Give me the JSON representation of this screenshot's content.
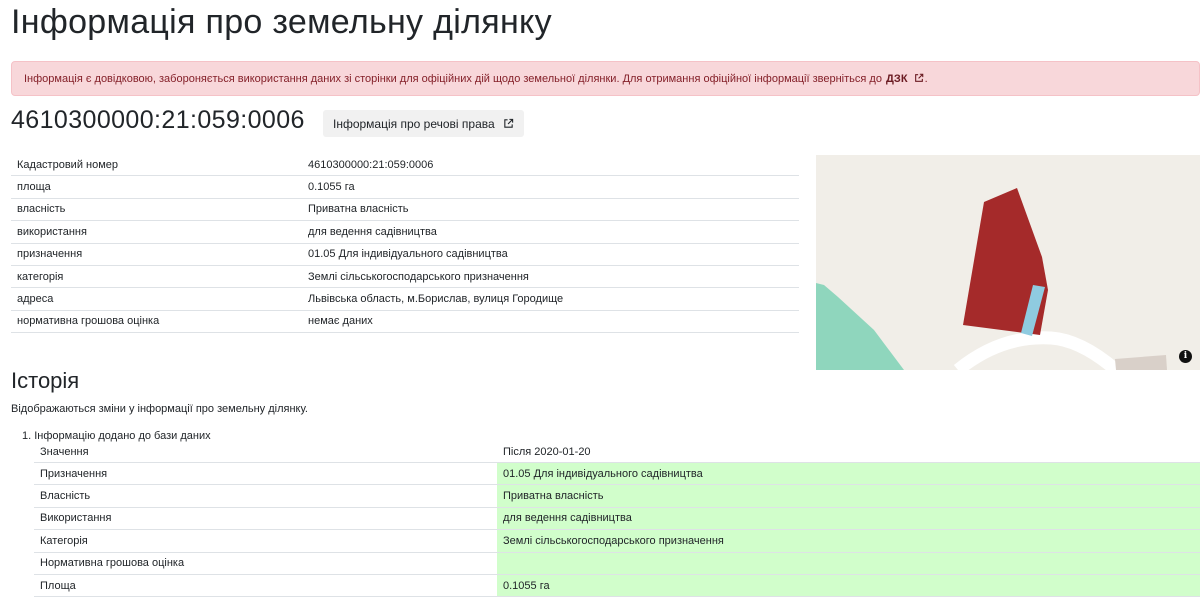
{
  "page": {
    "title": "Інформація про земельну ділянку"
  },
  "alert": {
    "text": "Інформація є довідковою, забороняється використання даних зі сторінки для офіційних дій щодо земельної ділянки. Для отримання офіційної інформації зверніться до",
    "link_label": "ДЗК",
    "end": "."
  },
  "parcel": {
    "heading": "4610300000:21:059:0006",
    "rights_button_label": "Інформація про речові права"
  },
  "info_rows": [
    {
      "label": "Кадастровий номер",
      "value": "4610300000:21:059:0006"
    },
    {
      "label": "площа",
      "value": "0.1055 га"
    },
    {
      "label": "власність",
      "value": "Приватна власність"
    },
    {
      "label": "використання",
      "value": "для ведення садівництва"
    },
    {
      "label": "призначення",
      "value": "01.05 Для індивідуального садівництва"
    },
    {
      "label": "категорія",
      "value": "Землі сільськогосподарського призначення"
    },
    {
      "label": "адреса",
      "value": "Львівська область, м.Борислав, вулиця Городище"
    },
    {
      "label": "нормативна грошова оцінка",
      "value": "немає даних"
    }
  ],
  "map": {
    "info_icon": "i",
    "colors": {
      "background": "#f1eee8",
      "parcel": "#a52a2a",
      "adjacent": "#8fcbe0",
      "green": "#8fd6bd",
      "road": "#ffffff",
      "building": "#d9d0c9"
    }
  },
  "history": {
    "title": "Історія",
    "description": "Відображаються зміни у інформації про земельну ділянку.",
    "item_title": "1. Інформацію додано до бази даних",
    "header": {
      "label": "Значення",
      "value": "Після 2020-01-20"
    },
    "rows": [
      {
        "label": "Призначення",
        "value": "01.05 Для індивідуального садівництва"
      },
      {
        "label": "Власність",
        "value": "Приватна власність"
      },
      {
        "label": "Використання",
        "value": "для ведення садівництва"
      },
      {
        "label": "Категорія",
        "value": "Землі сільськогосподарського призначення"
      },
      {
        "label": "Нормативна грошова оцінка",
        "value": ""
      },
      {
        "label": "Площа",
        "value": "0.1055 га"
      }
    ],
    "highlight_color": "#d1fecb"
  }
}
